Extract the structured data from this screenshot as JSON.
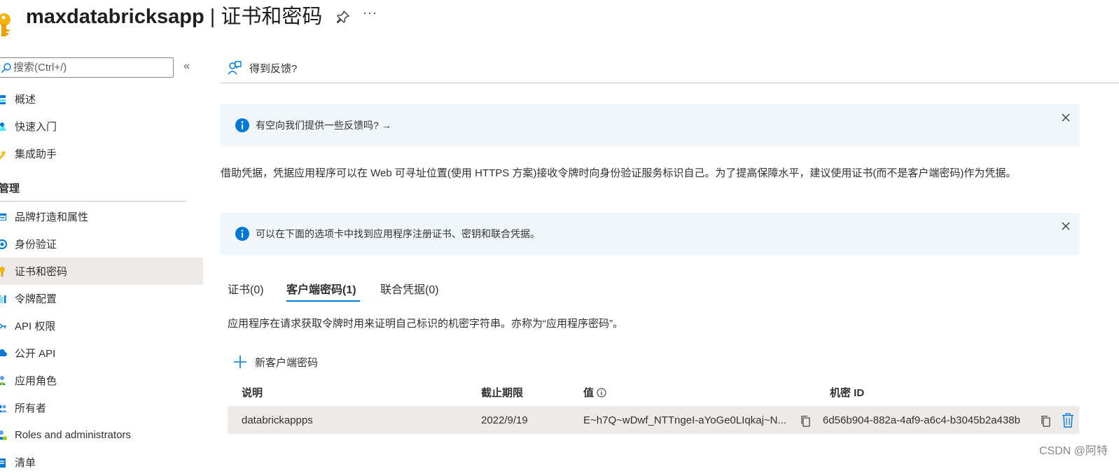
{
  "header": {
    "app_name": "maxdatabricksapp",
    "separator": " | ",
    "page_name": "证书和密码",
    "more_label": "···"
  },
  "sidebar": {
    "search_placeholder": "搜索(Ctrl+/)",
    "collapse_label": "«",
    "top_items": [
      {
        "label": "概述",
        "icon": "overview-icon"
      },
      {
        "label": "快速入门",
        "icon": "quickstart-icon"
      },
      {
        "label": "集成助手",
        "icon": "integration-assistant-icon"
      }
    ],
    "section_title": "管理",
    "manage_items": [
      {
        "label": "品牌打造和属性",
        "icon": "branding-icon"
      },
      {
        "label": "身份验证",
        "icon": "authentication-icon"
      },
      {
        "label": "证书和密码",
        "icon": "key-icon",
        "active": true
      },
      {
        "label": "令牌配置",
        "icon": "token-config-icon"
      },
      {
        "label": "API 权限",
        "icon": "api-permissions-icon"
      },
      {
        "label": "公开 API",
        "icon": "expose-api-icon"
      },
      {
        "label": "应用角色",
        "icon": "app-roles-icon"
      },
      {
        "label": "所有者",
        "icon": "owners-icon"
      },
      {
        "label": "Roles and administrators",
        "icon": "roles-admins-icon"
      },
      {
        "label": "清单",
        "icon": "manifest-icon"
      }
    ]
  },
  "toolbar": {
    "feedback_label": "得到反馈?"
  },
  "banners": [
    {
      "text": "有空向我们提供一些反馈吗?",
      "arrow": "→"
    },
    {
      "text": "可以在下面的选项卡中找到应用程序注册证书、密钥和联合凭据。"
    }
  ],
  "description": "借助凭据，凭据应用程序可以在 Web 可寻址位置(使用 HTTPS 方案)接收令牌时向身份验证服务标识自己。为了提高保障水平，建议使用证书(而不是客户端密码)作为凭据。",
  "tabs": [
    {
      "label": "证书(0)"
    },
    {
      "label": "客户端密码(1)",
      "selected": true
    },
    {
      "label": "联合凭据(0)"
    }
  ],
  "tab_description": "应用程序在请求获取令牌时用来证明自己标识的机密字符串。亦称为“应用程序密码”。",
  "new_secret_label": "新客户端密码",
  "table": {
    "columns": [
      "说明",
      "截止期限",
      "值",
      "机密 ID"
    ],
    "rows": [
      {
        "description": "databrickappps",
        "expires": "2022/9/19",
        "value": "E~h7Q~wDwf_NTTngeI-aYoGe0LIqkaj~N...",
        "secret_id": "6d56b904-882a-4af9-a6c4-b3045b2a438b"
      }
    ]
  },
  "watermark": "CSDN @阿特",
  "colors": {
    "accent": "#0078d4",
    "banner_bg": "#eff6fc",
    "active_bg": "#edebe9",
    "key_yellow": "#f2b50f"
  }
}
